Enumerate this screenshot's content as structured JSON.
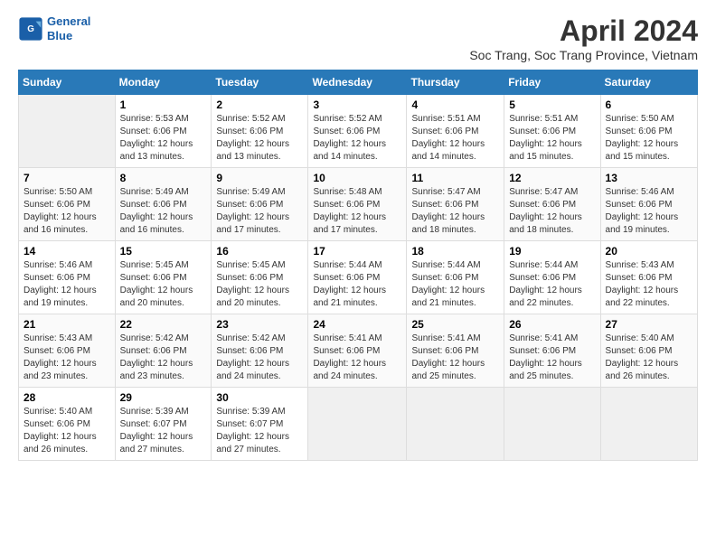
{
  "header": {
    "logo_line1": "General",
    "logo_line2": "Blue",
    "title": "April 2024",
    "subtitle": "Soc Trang, Soc Trang Province, Vietnam"
  },
  "columns": [
    "Sunday",
    "Monday",
    "Tuesday",
    "Wednesday",
    "Thursday",
    "Friday",
    "Saturday"
  ],
  "weeks": [
    [
      {
        "day": "",
        "info": ""
      },
      {
        "day": "1",
        "info": "Sunrise: 5:53 AM\nSunset: 6:06 PM\nDaylight: 12 hours\nand 13 minutes."
      },
      {
        "day": "2",
        "info": "Sunrise: 5:52 AM\nSunset: 6:06 PM\nDaylight: 12 hours\nand 13 minutes."
      },
      {
        "day": "3",
        "info": "Sunrise: 5:52 AM\nSunset: 6:06 PM\nDaylight: 12 hours\nand 14 minutes."
      },
      {
        "day": "4",
        "info": "Sunrise: 5:51 AM\nSunset: 6:06 PM\nDaylight: 12 hours\nand 14 minutes."
      },
      {
        "day": "5",
        "info": "Sunrise: 5:51 AM\nSunset: 6:06 PM\nDaylight: 12 hours\nand 15 minutes."
      },
      {
        "day": "6",
        "info": "Sunrise: 5:50 AM\nSunset: 6:06 PM\nDaylight: 12 hours\nand 15 minutes."
      }
    ],
    [
      {
        "day": "7",
        "info": "Sunrise: 5:50 AM\nSunset: 6:06 PM\nDaylight: 12 hours\nand 16 minutes."
      },
      {
        "day": "8",
        "info": "Sunrise: 5:49 AM\nSunset: 6:06 PM\nDaylight: 12 hours\nand 16 minutes."
      },
      {
        "day": "9",
        "info": "Sunrise: 5:49 AM\nSunset: 6:06 PM\nDaylight: 12 hours\nand 17 minutes."
      },
      {
        "day": "10",
        "info": "Sunrise: 5:48 AM\nSunset: 6:06 PM\nDaylight: 12 hours\nand 17 minutes."
      },
      {
        "day": "11",
        "info": "Sunrise: 5:47 AM\nSunset: 6:06 PM\nDaylight: 12 hours\nand 18 minutes."
      },
      {
        "day": "12",
        "info": "Sunrise: 5:47 AM\nSunset: 6:06 PM\nDaylight: 12 hours\nand 18 minutes."
      },
      {
        "day": "13",
        "info": "Sunrise: 5:46 AM\nSunset: 6:06 PM\nDaylight: 12 hours\nand 19 minutes."
      }
    ],
    [
      {
        "day": "14",
        "info": "Sunrise: 5:46 AM\nSunset: 6:06 PM\nDaylight: 12 hours\nand 19 minutes."
      },
      {
        "day": "15",
        "info": "Sunrise: 5:45 AM\nSunset: 6:06 PM\nDaylight: 12 hours\nand 20 minutes."
      },
      {
        "day": "16",
        "info": "Sunrise: 5:45 AM\nSunset: 6:06 PM\nDaylight: 12 hours\nand 20 minutes."
      },
      {
        "day": "17",
        "info": "Sunrise: 5:44 AM\nSunset: 6:06 PM\nDaylight: 12 hours\nand 21 minutes."
      },
      {
        "day": "18",
        "info": "Sunrise: 5:44 AM\nSunset: 6:06 PM\nDaylight: 12 hours\nand 21 minutes."
      },
      {
        "day": "19",
        "info": "Sunrise: 5:44 AM\nSunset: 6:06 PM\nDaylight: 12 hours\nand 22 minutes."
      },
      {
        "day": "20",
        "info": "Sunrise: 5:43 AM\nSunset: 6:06 PM\nDaylight: 12 hours\nand 22 minutes."
      }
    ],
    [
      {
        "day": "21",
        "info": "Sunrise: 5:43 AM\nSunset: 6:06 PM\nDaylight: 12 hours\nand 23 minutes."
      },
      {
        "day": "22",
        "info": "Sunrise: 5:42 AM\nSunset: 6:06 PM\nDaylight: 12 hours\nand 23 minutes."
      },
      {
        "day": "23",
        "info": "Sunrise: 5:42 AM\nSunset: 6:06 PM\nDaylight: 12 hours\nand 24 minutes."
      },
      {
        "day": "24",
        "info": "Sunrise: 5:41 AM\nSunset: 6:06 PM\nDaylight: 12 hours\nand 24 minutes."
      },
      {
        "day": "25",
        "info": "Sunrise: 5:41 AM\nSunset: 6:06 PM\nDaylight: 12 hours\nand 25 minutes."
      },
      {
        "day": "26",
        "info": "Sunrise: 5:41 AM\nSunset: 6:06 PM\nDaylight: 12 hours\nand 25 minutes."
      },
      {
        "day": "27",
        "info": "Sunrise: 5:40 AM\nSunset: 6:06 PM\nDaylight: 12 hours\nand 26 minutes."
      }
    ],
    [
      {
        "day": "28",
        "info": "Sunrise: 5:40 AM\nSunset: 6:06 PM\nDaylight: 12 hours\nand 26 minutes."
      },
      {
        "day": "29",
        "info": "Sunrise: 5:39 AM\nSunset: 6:07 PM\nDaylight: 12 hours\nand 27 minutes."
      },
      {
        "day": "30",
        "info": "Sunrise: 5:39 AM\nSunset: 6:07 PM\nDaylight: 12 hours\nand 27 minutes."
      },
      {
        "day": "",
        "info": ""
      },
      {
        "day": "",
        "info": ""
      },
      {
        "day": "",
        "info": ""
      },
      {
        "day": "",
        "info": ""
      }
    ]
  ]
}
